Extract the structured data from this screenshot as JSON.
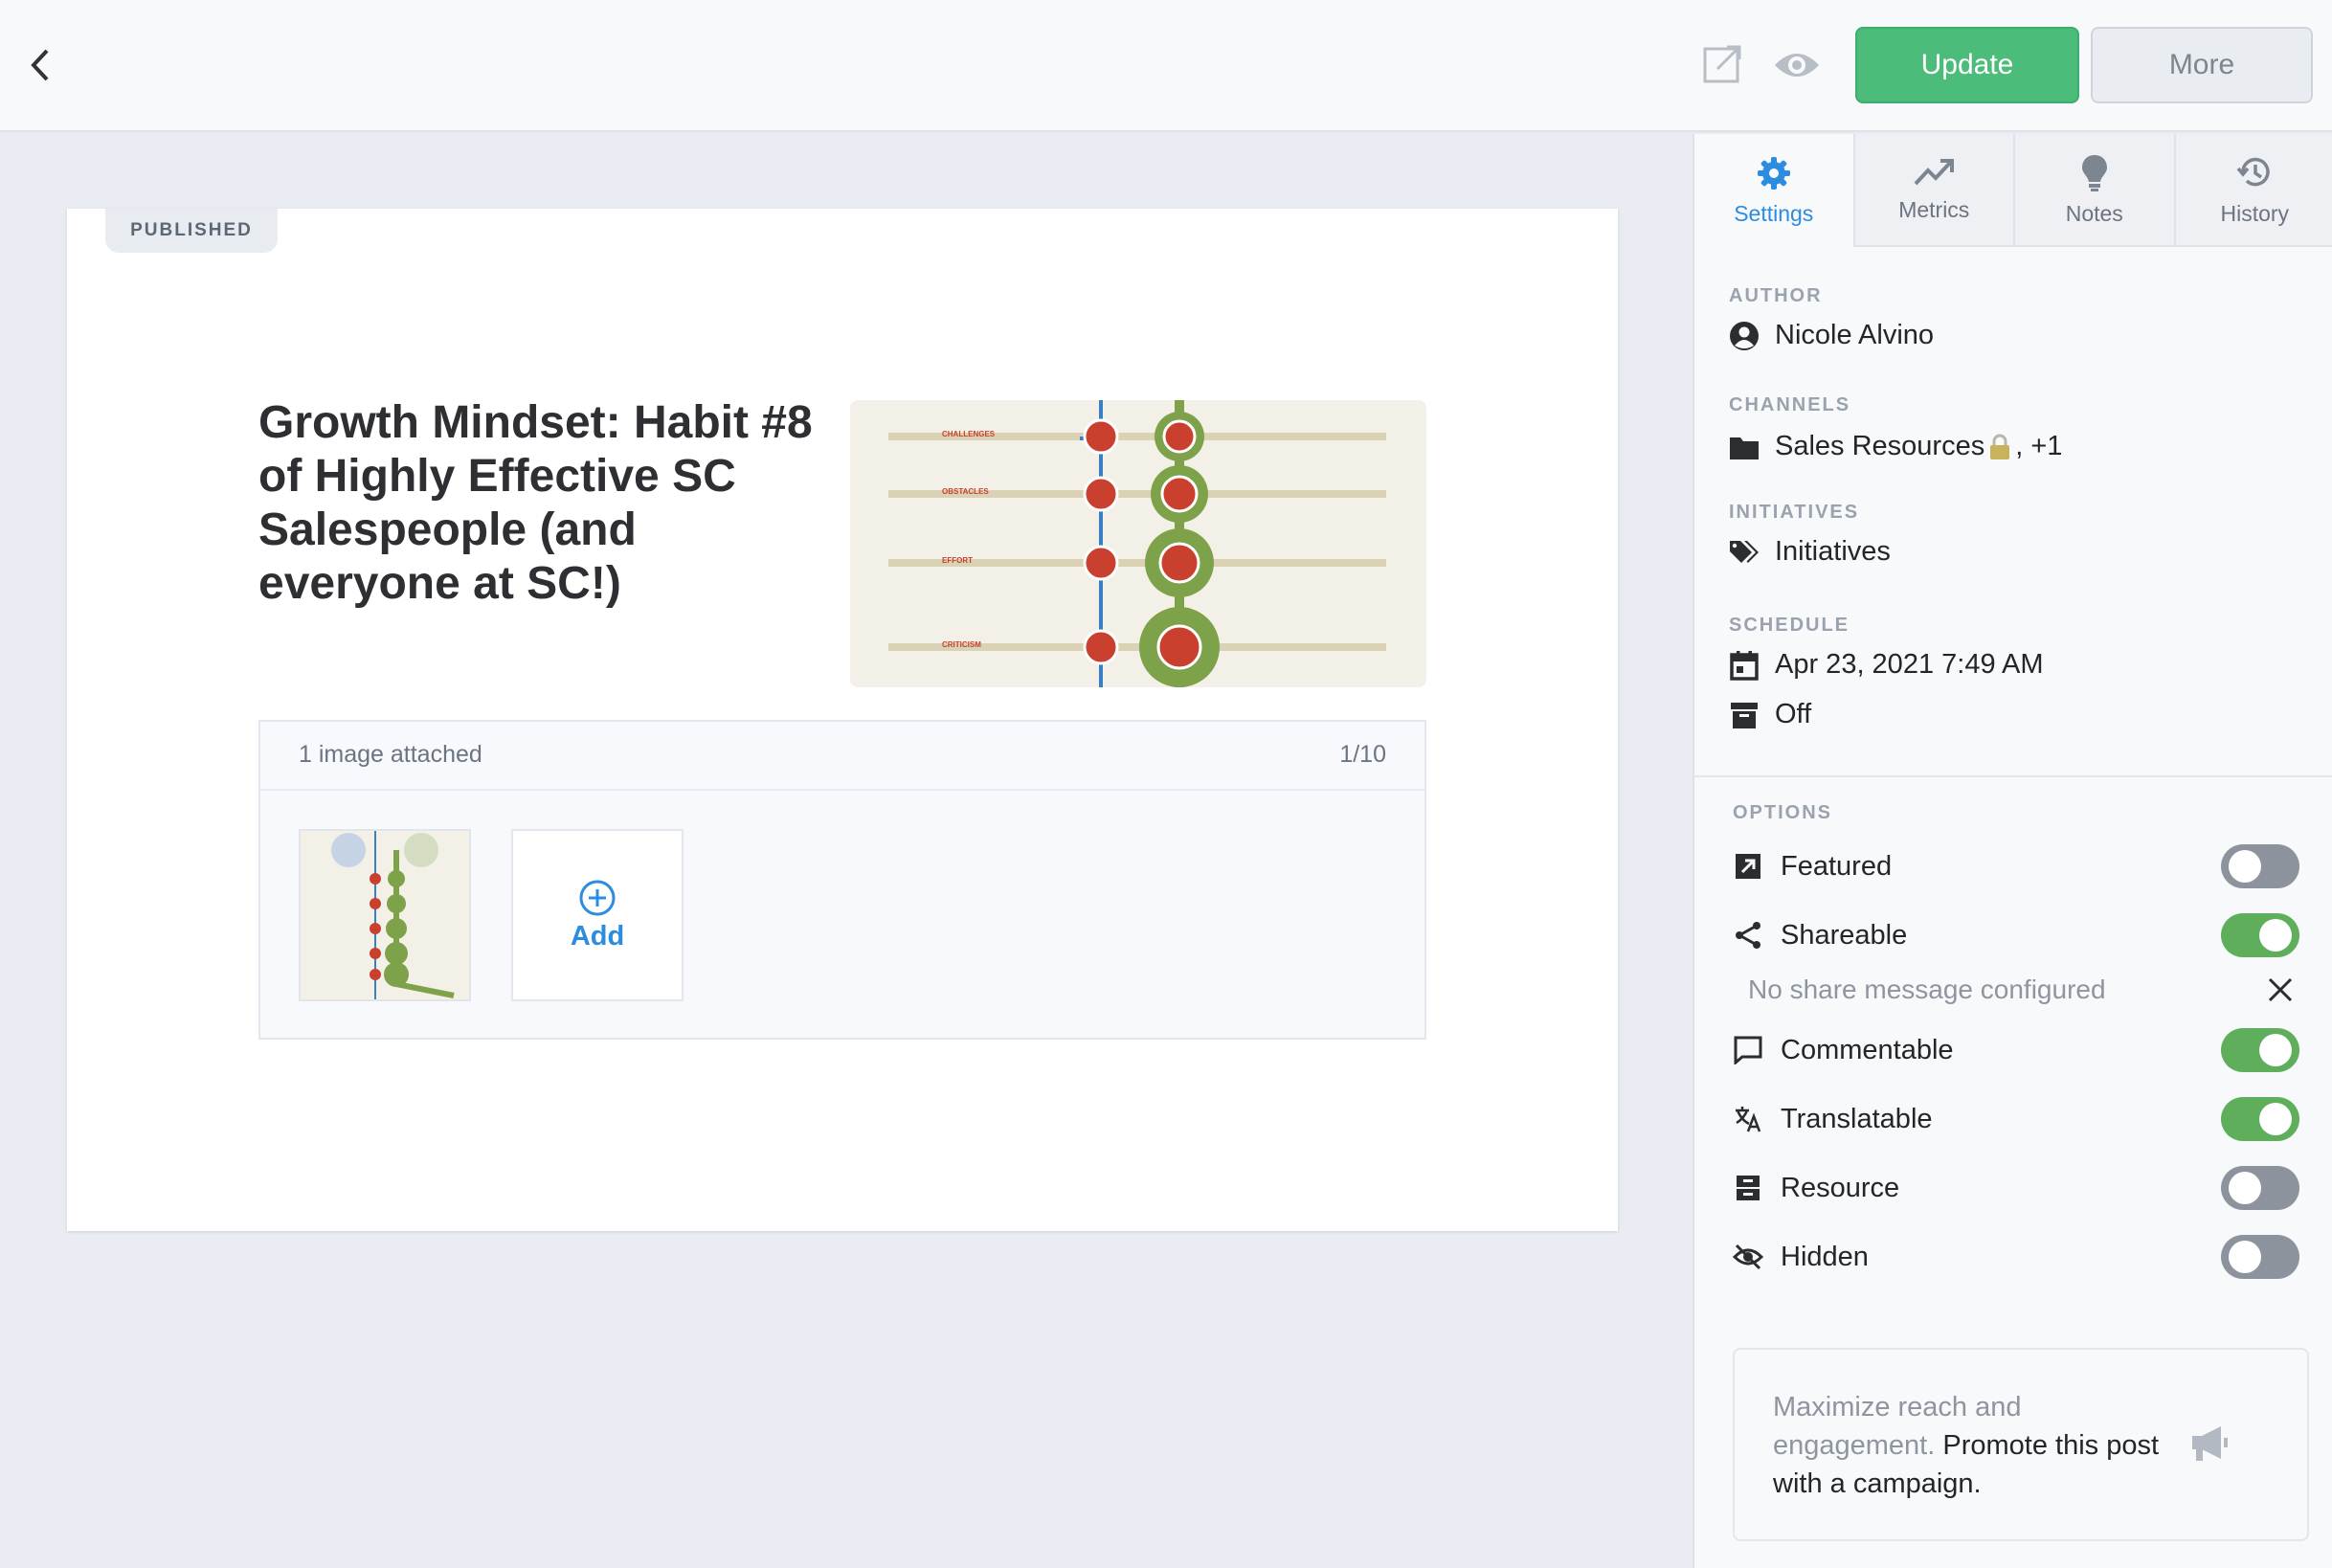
{
  "toolbar": {
    "update_label": "Update",
    "more_label": "More"
  },
  "post": {
    "status": "PUBLISHED",
    "title": "Growth Mindset: Habit #8 of Highly Effective SC Salespeople (and everyone at SC!)",
    "cover_labels": [
      "CHALLENGES",
      "OBSTACLES",
      "EFFORT",
      "CRITICISM"
    ],
    "attachments": {
      "count_label": "1 image attached",
      "limit_label": "1/10",
      "add_label": "Add"
    }
  },
  "sidebar": {
    "tabs": [
      {
        "label": "Settings",
        "icon": "gear-icon",
        "active": true
      },
      {
        "label": "Metrics",
        "icon": "trend-icon",
        "active": false
      },
      {
        "label": "Notes",
        "icon": "lightbulb-icon",
        "active": false
      },
      {
        "label": "History",
        "icon": "history-icon",
        "active": false
      }
    ],
    "author": {
      "label": "AUTHOR",
      "name": "Nicole Alvino"
    },
    "channels": {
      "label": "CHANNELS",
      "value": "Sales Resources",
      "extra": ", +1"
    },
    "initiatives": {
      "label": "INITIATIVES",
      "value": "Initiatives"
    },
    "schedule": {
      "label": "SCHEDULE",
      "date": "Apr 23, 2021 7:49 AM",
      "expiry": "Off"
    },
    "options": {
      "label": "OPTIONS",
      "items": [
        {
          "label": "Featured",
          "icon": "featured-icon",
          "on": false
        },
        {
          "label": "Shareable",
          "icon": "share-icon",
          "on": true
        },
        {
          "label": "Commentable",
          "icon": "comment-icon",
          "on": true
        },
        {
          "label": "Translatable",
          "icon": "translate-icon",
          "on": true
        },
        {
          "label": "Resource",
          "icon": "resource-icon",
          "on": false
        },
        {
          "label": "Hidden",
          "icon": "hidden-icon",
          "on": false
        }
      ],
      "share_message": "No share message configured"
    },
    "promo": {
      "text_muted": "Maximize reach and engagement.",
      "text_strong": "Promote this post with a campaign."
    }
  },
  "colors": {
    "primary_green": "#4cbc7a",
    "accent_blue": "#2b8ce0",
    "toggle_on": "#5eae5c",
    "toggle_off": "#8c939d"
  }
}
